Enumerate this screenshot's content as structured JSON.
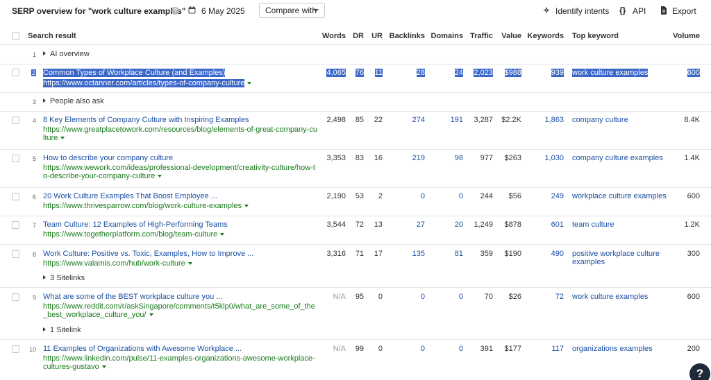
{
  "header": {
    "title": "SERP overview for \"work culture examples\"",
    "help": "?",
    "date": "6 May 2025",
    "compare_label": "Compare with",
    "identify_label": "Identify intents",
    "api_label": "API",
    "export_label": "Export"
  },
  "columns": {
    "search_result": "Search result",
    "words": "Words",
    "dr": "DR",
    "ur": "UR",
    "backlinks": "Backlinks",
    "domains": "Domains",
    "traffic": "Traffic",
    "value": "Value",
    "keywords": "Keywords",
    "top_keyword": "Top keyword",
    "volume": "Volume"
  },
  "rows": [
    {
      "num": "1",
      "label": "AI overview"
    },
    {
      "num": "2",
      "title": "Common Types of Workplace Culture (and Examples)",
      "url": "https://www.octanner.com/articles/types-of-company-culture",
      "words": "4,065",
      "dr": "76",
      "ur": "11",
      "backlinks": "28",
      "domains": "24",
      "traffic": "2,023",
      "value": "$988",
      "keywords": "939",
      "top_keyword": "work culture examples",
      "volume": "600"
    },
    {
      "num": "3",
      "label": "People also ask"
    },
    {
      "num": "4",
      "title": "8 Key Elements of Company Culture with Inspiring Examples",
      "url1": "https://www.greatplacetowork.com/resources/blog/elements-of-great-company-cu",
      "url2": "lture",
      "words": "2,498",
      "dr": "85",
      "ur": "22",
      "backlinks": "274",
      "domains": "191",
      "traffic": "3,287",
      "value": "$2.2K",
      "keywords": "1,863",
      "top_keyword": "company culture",
      "volume": "8.4K"
    },
    {
      "num": "5",
      "title": "How to describe your company culture",
      "url1": "https://www.wework.com/ideas/professional-development/creativity-culture/how-t",
      "url2": "o-describe-your-company-culture",
      "words": "3,353",
      "dr": "83",
      "ur": "16",
      "backlinks": "219",
      "domains": "98",
      "traffic": "977",
      "value": "$263",
      "keywords": "1,030",
      "top_keyword": "company culture examples",
      "volume": "1.4K"
    },
    {
      "num": "6",
      "title": "20 Work Culture Examples That Boost Employee ...",
      "url": "https://www.thrivesparrow.com/blog/work-culture-examples",
      "words": "2,190",
      "dr": "53",
      "ur": "2",
      "backlinks": "0",
      "domains": "0",
      "traffic": "244",
      "value": "$56",
      "keywords": "249",
      "top_keyword": "workplace culture examples",
      "volume": "600"
    },
    {
      "num": "7",
      "title": "Team Culture: 12 Examples of High-Performing Teams",
      "url": "https://www.togetherplatform.com/blog/team-culture",
      "words": "3,544",
      "dr": "72",
      "ur": "13",
      "backlinks": "27",
      "domains": "20",
      "traffic": "1,249",
      "value": "$878",
      "keywords": "601",
      "top_keyword": "team culture",
      "volume": "1.2K"
    },
    {
      "num": "8",
      "title": "Work Culture: Positive vs. Toxic, Examples, How to Improve ...",
      "url": "https://www.valamis.com/hub/work-culture",
      "sitelinks": "3 Sitelinks",
      "words": "3,316",
      "dr": "71",
      "ur": "17",
      "backlinks": "135",
      "domains": "81",
      "traffic": "359",
      "value": "$190",
      "keywords": "490",
      "top_keyword1": "positive workplace culture",
      "top_keyword2": "examples",
      "volume": "300"
    },
    {
      "num": "9",
      "title": "What are some of the BEST workplace culture you ...",
      "url1": "https://www.reddit.com/r/askSingapore/comments/t5klp0/what_are_some_of_the",
      "url2": "_best_workplace_culture_you/",
      "sitelinks": "1 Sitelink",
      "words": "N/A",
      "dr": "95",
      "ur": "0",
      "backlinks": "0",
      "domains": "0",
      "traffic": "70",
      "value": "$26",
      "keywords": "72",
      "top_keyword": "work culture examples",
      "volume": "600"
    },
    {
      "num": "10",
      "title": "11 Examples of Organizations with Awesome Workplace ...",
      "url1": "https://www.linkedin.com/pulse/11-examples-organizations-awesome-workplace-",
      "url2": "cultures-gustavo",
      "words": "N/A",
      "dr": "99",
      "ur": "0",
      "backlinks": "0",
      "domains": "0",
      "traffic": "391",
      "value": "$177",
      "keywords": "117",
      "top_keyword": "organizations examples",
      "volume": "200"
    }
  ],
  "help_button": "?"
}
